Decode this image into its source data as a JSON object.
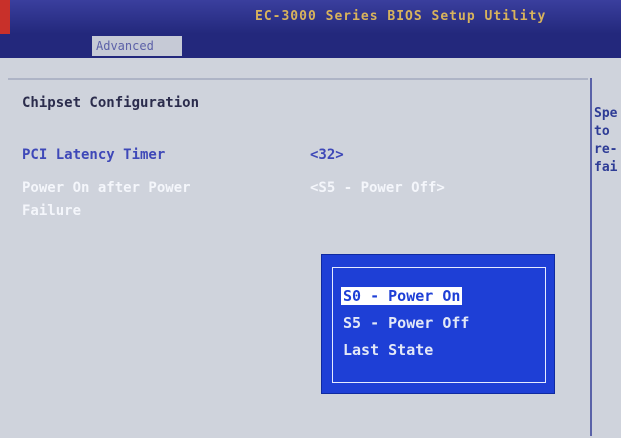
{
  "title": "EC-3000 Series BIOS Setup Utility",
  "tabs": {
    "active": "Advanced"
  },
  "section": {
    "title": "Chipset Configuration"
  },
  "settings": [
    {
      "label": "PCI Latency Timer",
      "value": "<32>"
    },
    {
      "label_line1": "Power On after Power",
      "label_line2": "Failure",
      "value": "<S5 - Power Off>"
    }
  ],
  "popup": {
    "options": [
      "S0 - Power On",
      "S5 - Power Off",
      "Last State"
    ],
    "selected": "S0 - Power On"
  },
  "help": {
    "lines": [
      "Spe",
      "to",
      "re-",
      "fai"
    ]
  },
  "colors": {
    "header": "#23287c",
    "popup": "#1e3fd6",
    "selected_text": "#3e48b8"
  }
}
